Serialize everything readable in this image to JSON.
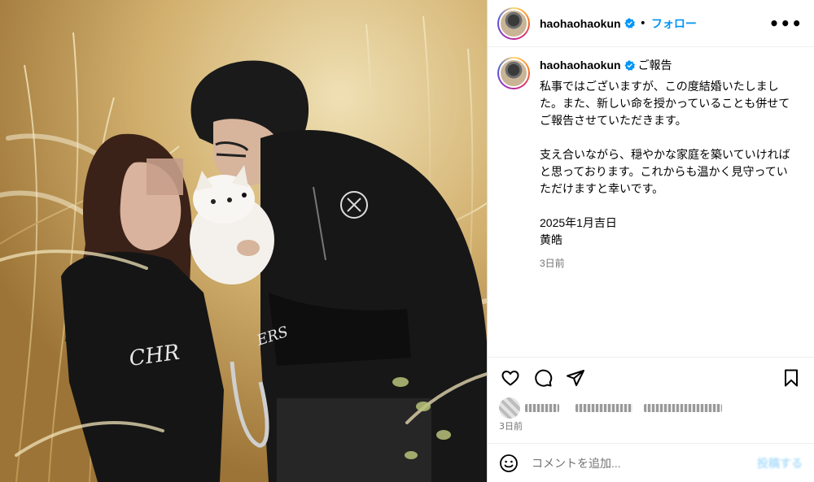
{
  "header": {
    "username": "haohaohaokun",
    "separator": "•",
    "follow_label": "フォロー",
    "more_label": "•••"
  },
  "caption": {
    "username": "haohaohaokun",
    "title": "ご報告",
    "text": "私事ではございますが、この度結婚いたしました。また、新しい命を授かっていることも併せてご報告させていただきます。\n\n支え合いながら、穏やかな家庭を築いていければと思っております。これからも温かく見守っていただけますと幸いです。\n\n2025年1月吉日\n黄皓",
    "time": "3日前"
  },
  "actions": {
    "icons": [
      "heart-icon",
      "comment-icon",
      "share-icon",
      "bookmark-icon"
    ]
  },
  "likes": {
    "time": "3日前"
  },
  "comment": {
    "placeholder": "コメントを追加...",
    "post_label": "投稿する"
  },
  "colors": {
    "accent": "#0095f6",
    "muted": "#737373",
    "border": "#dbdbdb"
  }
}
